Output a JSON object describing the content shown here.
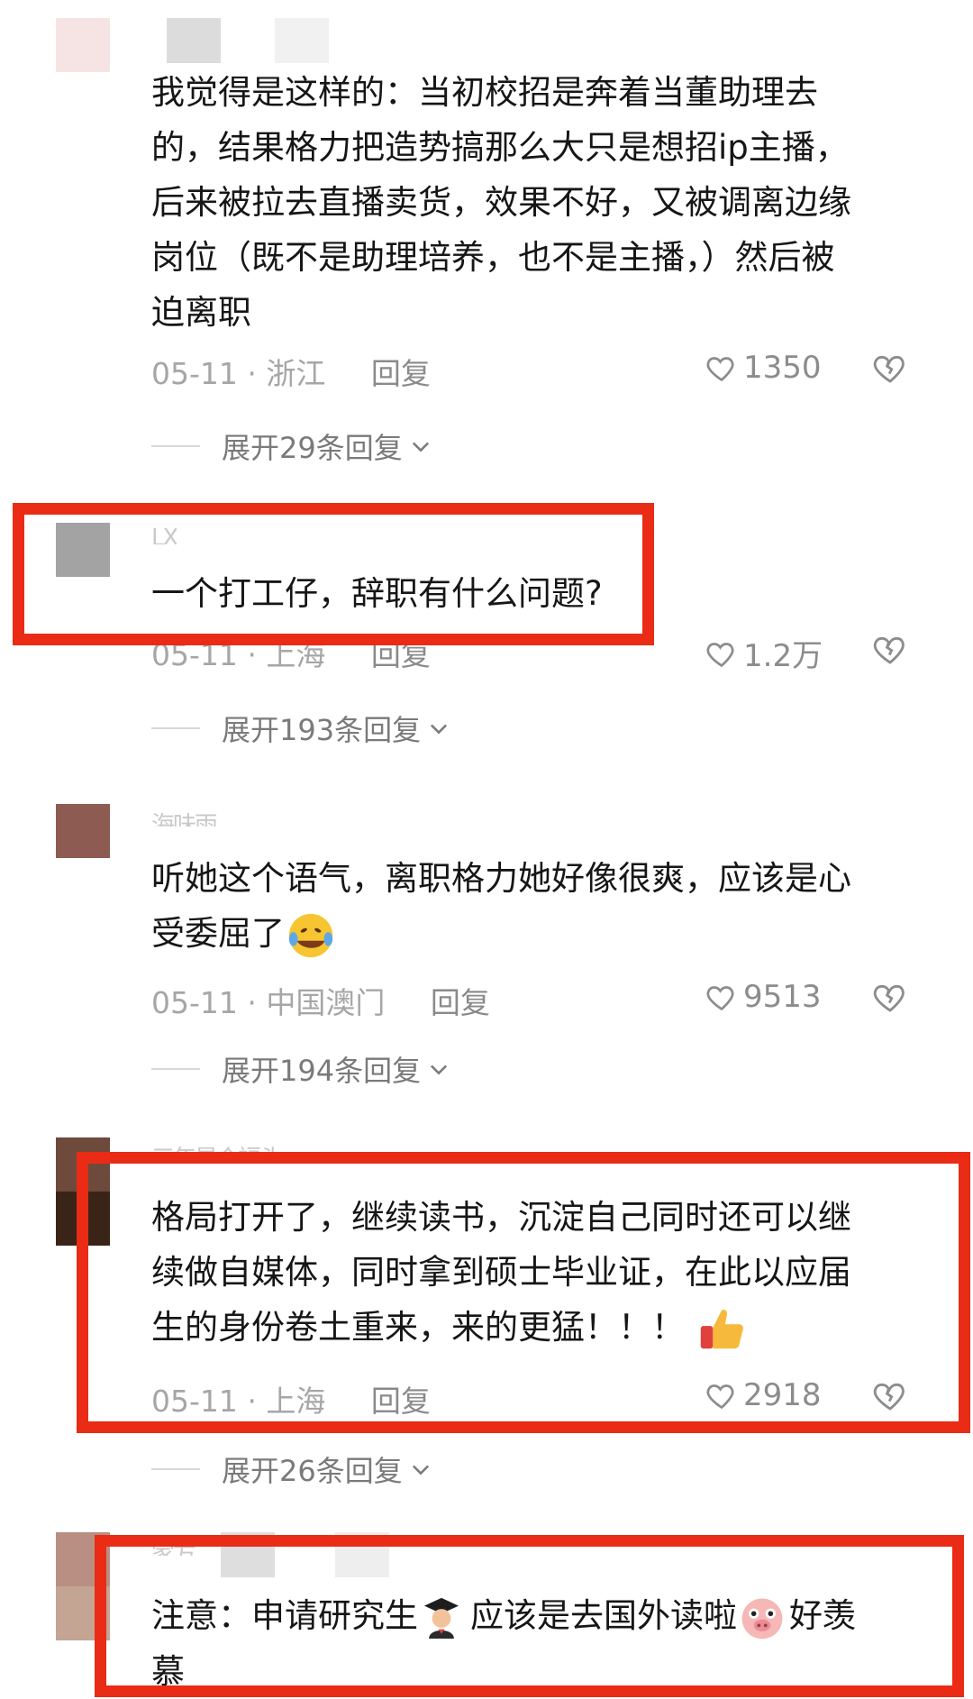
{
  "comments": [
    {
      "text": "我觉得是这样的：当初校招是奔着当董助理去的，结果格力把造势搞那么大只是想招ip主播，后来被拉去直播卖货，效果不好，又被调离边缘岗位（既不是助理培养，也不是主播，）然后被迫离职",
      "lines": [
        "我觉得是这样的：当初校招是奔着当董助理去",
        "的，结果格力把造势搞那么大只是想招ip主播，",
        "后来被拉去直播卖货，效果不好，又被调离边缘",
        "岗位（既不是助理培养，也不是主播，）然后被",
        "迫离职"
      ],
      "date": "05-11",
      "location": "浙江",
      "reply_label": "回复",
      "likes": "1350",
      "expand_label": "展开29条回复"
    },
    {
      "username": "LX",
      "lines": [
        "一个打工仔，辞职有什么问题?"
      ],
      "date": "05-11",
      "location": "上海",
      "reply_label": "回复",
      "likes": "1.2万",
      "expand_label": "展开193条回复"
    },
    {
      "username": "海味雨",
      "lines": [
        "听她这个语气，离职格力她好像很爽，应该是心",
        "受委屈了"
      ],
      "emoji": "rofl-emoji",
      "date": "05-11",
      "location": "中国澳门",
      "reply_label": "回复",
      "likes": "9513",
      "expand_label": "展开194条回复"
    },
    {
      "username": "三年是个福头",
      "lines": [
        "格局打开了，继续读书，沉淀自己同时还可以继",
        "续做自媒体，同时拿到硕士毕业证，在此以应届",
        "生的身份卷土重来，来的更猛！！！"
      ],
      "emoji": "thumbs-up-emoji",
      "date": "05-11",
      "location": "上海",
      "reply_label": "回复",
      "likes": "2918",
      "expand_label": "展开26条回复"
    },
    {
      "username": "家方",
      "lines": [
        "注意：申请研究生",
        "应该是去国外读啦",
        "好羡",
        "慕"
      ],
      "emojis": [
        "graduate-emoji",
        "pig-emoji"
      ],
      "date": "",
      "location": "",
      "reply_label": "",
      "likes": "",
      "expand_label": ""
    }
  ],
  "colors": {
    "highlight_border": "#ea2b15",
    "meta_text": "#a6a6a6",
    "body_text": "#161616"
  },
  "separator": "·"
}
